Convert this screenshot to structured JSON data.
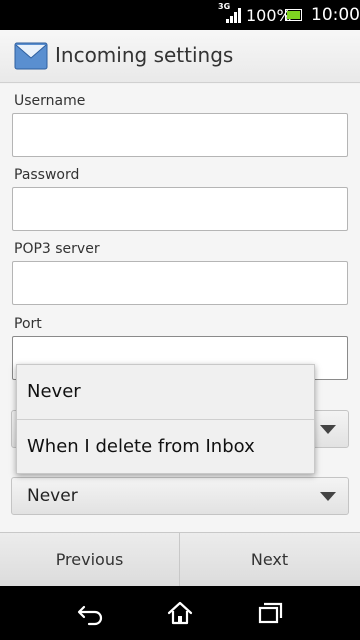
{
  "status_bar": {
    "network": "3G",
    "battery_percent": "100%",
    "time": "10:00",
    "icons": [
      "signal-icon",
      "battery-icon"
    ]
  },
  "action_bar": {
    "title": "Incoming settings",
    "icon": "mail-icon"
  },
  "form": {
    "username_label": "Username",
    "username_value": "",
    "password_label": "Password",
    "password_value": "",
    "server_label": "POP3 server",
    "server_value": "",
    "port_label": "Port",
    "port_value": "",
    "spinner1_value": "",
    "spinner2_value": "Never"
  },
  "popup": {
    "options": [
      "Never",
      "When I delete from Inbox"
    ]
  },
  "bottom_bar": {
    "previous_label": "Previous",
    "next_label": "Next"
  },
  "nav_bar": {
    "icons": [
      "back-icon",
      "home-icon",
      "recent-apps-icon"
    ]
  }
}
